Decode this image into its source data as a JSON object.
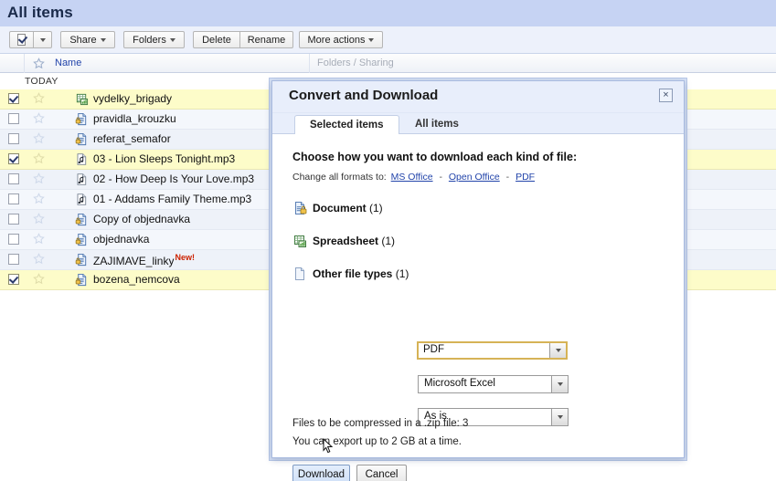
{
  "page": {
    "title": "All items"
  },
  "toolbar": {
    "select_all_label": "",
    "share_label": "Share",
    "folders_label": "Folders",
    "delete_label": "Delete",
    "rename_label": "Rename",
    "more_actions_label": "More actions"
  },
  "columns": {
    "name": "Name",
    "folders_sharing": "Folders / Sharing"
  },
  "list": {
    "group_label": "TODAY",
    "rows": [
      {
        "name": "vydelky_brigady",
        "icon": "spreadsheet-icon",
        "checked": true,
        "selected": true,
        "badge": ""
      },
      {
        "name": "pravidla_krouzku",
        "icon": "document-icon",
        "checked": false,
        "selected": false,
        "badge": ""
      },
      {
        "name": "referat_semafor",
        "icon": "document-icon",
        "checked": false,
        "selected": false,
        "badge": ""
      },
      {
        "name": "03 - Lion Sleeps Tonight.mp3",
        "icon": "audio-icon",
        "checked": true,
        "selected": true,
        "badge": ""
      },
      {
        "name": "02 - How Deep Is Your Love.mp3",
        "icon": "audio-icon",
        "checked": false,
        "selected": false,
        "badge": ""
      },
      {
        "name": "01 - Addams Family Theme.mp3",
        "icon": "audio-icon",
        "checked": false,
        "selected": false,
        "badge": ""
      },
      {
        "name": "Copy of objednavka",
        "icon": "document-icon",
        "checked": false,
        "selected": false,
        "badge": ""
      },
      {
        "name": "objednavka",
        "icon": "document-icon",
        "checked": false,
        "selected": false,
        "badge": ""
      },
      {
        "name": "ZAJIMAVE_linky",
        "icon": "document-icon",
        "checked": false,
        "selected": false,
        "badge": "New!"
      },
      {
        "name": "bozena_nemcova",
        "icon": "document-icon",
        "checked": true,
        "selected": true,
        "badge": ""
      }
    ]
  },
  "dialog": {
    "title": "Convert and Download",
    "close_label": "×",
    "tabs": [
      {
        "label": "Selected items",
        "active": true
      },
      {
        "label": "All items",
        "active": false
      }
    ],
    "heading": "Choose how you want to download each kind of file:",
    "change_all_label": "Change all formats to:",
    "change_all_links": [
      "MS Office",
      "Open Office",
      "PDF"
    ],
    "separator": "-",
    "format_rows": [
      {
        "icon": "document-icon",
        "label": "Document",
        "count": "(1)",
        "value": "PDF",
        "focused": true
      },
      {
        "icon": "spreadsheet-icon",
        "label": "Spreadsheet",
        "count": "(1)",
        "value": "Microsoft Excel",
        "focused": false
      },
      {
        "icon": "file-icon",
        "label": "Other file types",
        "count": "(1)",
        "value": "As is",
        "focused": false
      }
    ],
    "note_zip": "Files to be compressed in a .zip file: 3",
    "note_limit": "You can export up to 2 GB at a time.",
    "download_label": "Download",
    "cancel_label": "Cancel"
  },
  "colors": {
    "header_bg": "#c6d3f3",
    "selected_row": "#fdfcc9",
    "link": "#2244aa",
    "badge_new": "#cc2200",
    "focus_border": "#d6b356"
  }
}
